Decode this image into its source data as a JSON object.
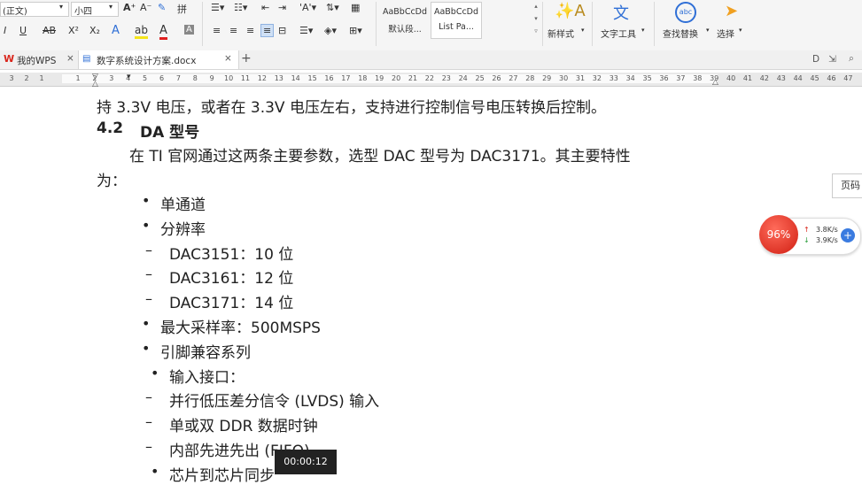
{
  "ribbon": {
    "style_select": "(正文)",
    "font_size_select": "小四",
    "grow_font": "A⁺",
    "shrink_font": "A⁻",
    "phonetic": "拼",
    "bold": "I",
    "underline": "U",
    "strike": "AB",
    "superscript": "X²",
    "subscript": "X₂",
    "style1_preview": "AaBbCcDd",
    "style1_name": "默认段...",
    "style2_preview": "AaBbCcDd",
    "style2_name": "List Pa...",
    "new_style": "新样式",
    "text_tools": "文字工具",
    "find_replace": "查找替换",
    "select": "选择",
    "colors": {
      "font_red": "#e02020",
      "highlight_yellow": "#f5e51b",
      "accent_blue": "#2f6fd6"
    }
  },
  "tabs": {
    "home": "我的WPS",
    "doc": "数字系统设计方案.docx",
    "close": "×",
    "new": "+"
  },
  "ruler": {
    "left_numbers": [
      "3",
      "2",
      "1"
    ],
    "numbers": [
      "1",
      "2",
      "3",
      "4",
      "5",
      "6",
      "7",
      "8",
      "9",
      "10",
      "11",
      "12",
      "13",
      "14",
      "15",
      "16",
      "17",
      "18",
      "19",
      "20",
      "21",
      "22",
      "23",
      "24",
      "25",
      "26",
      "27",
      "28",
      "29",
      "30",
      "31",
      "32",
      "33",
      "34",
      "35",
      "36",
      "37",
      "38",
      "39",
      "40",
      "41",
      "42",
      "43",
      "44",
      "45",
      "46",
      "47"
    ]
  },
  "document": {
    "line1": "持 3.3V 电压，或者在 3.3V 电压左右，支持进行控制信号电压转换后控制。",
    "heading_num": "4.2",
    "heading_text": "DA 型号",
    "para1": "在 TI 官网通过这两条主要参数，选型 DAC 型号为 DAC3171。其主要特性",
    "para1_cont": "为：",
    "items": [
      {
        "marker": "•",
        "text": "单通道"
      },
      {
        "marker": "•",
        "text": "分辨率"
      },
      {
        "marker": "–",
        "text": "DAC3151：10  位"
      },
      {
        "marker": "–",
        "text": "DAC3161：12  位"
      },
      {
        "marker": "–",
        "text": "DAC3171：14  位"
      },
      {
        "marker": "•",
        "text": "最大采样率：500MSPS"
      },
      {
        "marker": "•",
        "text": "引脚兼容系列"
      },
      {
        "marker": "•",
        "text": "输入接口："
      },
      {
        "marker": "–",
        "text": "并行低压差分信令 (LVDS) 输入"
      },
      {
        "marker": "–",
        "text": "单或双  DDR  数据时钟"
      },
      {
        "marker": "–",
        "text": "内部先进先出 (FIFO)"
      },
      {
        "marker": "•",
        "text": "芯片到芯片同步"
      }
    ]
  },
  "overlays": {
    "cpu_percent": "96%",
    "upload": "3.8K/s",
    "download": "3.9K/s",
    "timer": "00:00:12",
    "page_tip": "页码"
  }
}
